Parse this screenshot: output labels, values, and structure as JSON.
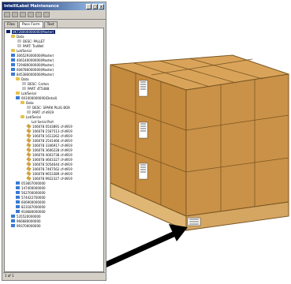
{
  "window": {
    "title": "IntelliLabel Maintenance",
    "controls": [
      "_",
      "□",
      "x"
    ],
    "tabs": [
      "Files",
      "Pass Form",
      "Text"
    ],
    "status": "1 of 1"
  },
  "tree": {
    "root": "0K728000000000(Master)",
    "pallet_data": "Data",
    "pallet_desc": "DESC: PALLET",
    "pallet_part": "PART: TruWell",
    "lot_serial": "Lot/Serial",
    "masters_top": [
      "306529300000(Master)",
      "406140000000(Master)",
      "729480000000(Master)",
      "608780000000(Master)",
      "845380000000(Master)"
    ],
    "carton_data": "Data",
    "carton_desc": "DESC: Carton",
    "carton_part": "PART: 4T5488",
    "carton_lot": "Lot/Serial",
    "detail": "001000000000(Detail)",
    "detail_data": "Data",
    "detail_desc": "DESC: SPARK PLUG BOX",
    "detail_part": "PART: cf-d919",
    "detail_lot": "Lot/Serial",
    "lot_header": "Lot  Serial  Part",
    "lot_rows": [
      "106078  0543891  cf-d919",
      "106078  1567513  cf-d919",
      "106078  1613262  cf-d919",
      "106078  2541466  cf-d919",
      "106078  3346917  cf-d919",
      "106078  3606228  cf-d919",
      "106078  4003738  cf-d919",
      "106078  4603327  cf-d919",
      "106078  5054644  cf-d919",
      "106078  7467562  cf-d919",
      "106078  9653389  cf-d919",
      "106078  9922327  cf-d919"
    ],
    "masters_bottom": [
      "053607000000",
      "147400000000",
      "562700000000",
      "574422700000",
      "606900000000",
      "823187000000",
      "918680000000",
      "535520000000",
      "966680000000",
      "993700000000"
    ]
  }
}
